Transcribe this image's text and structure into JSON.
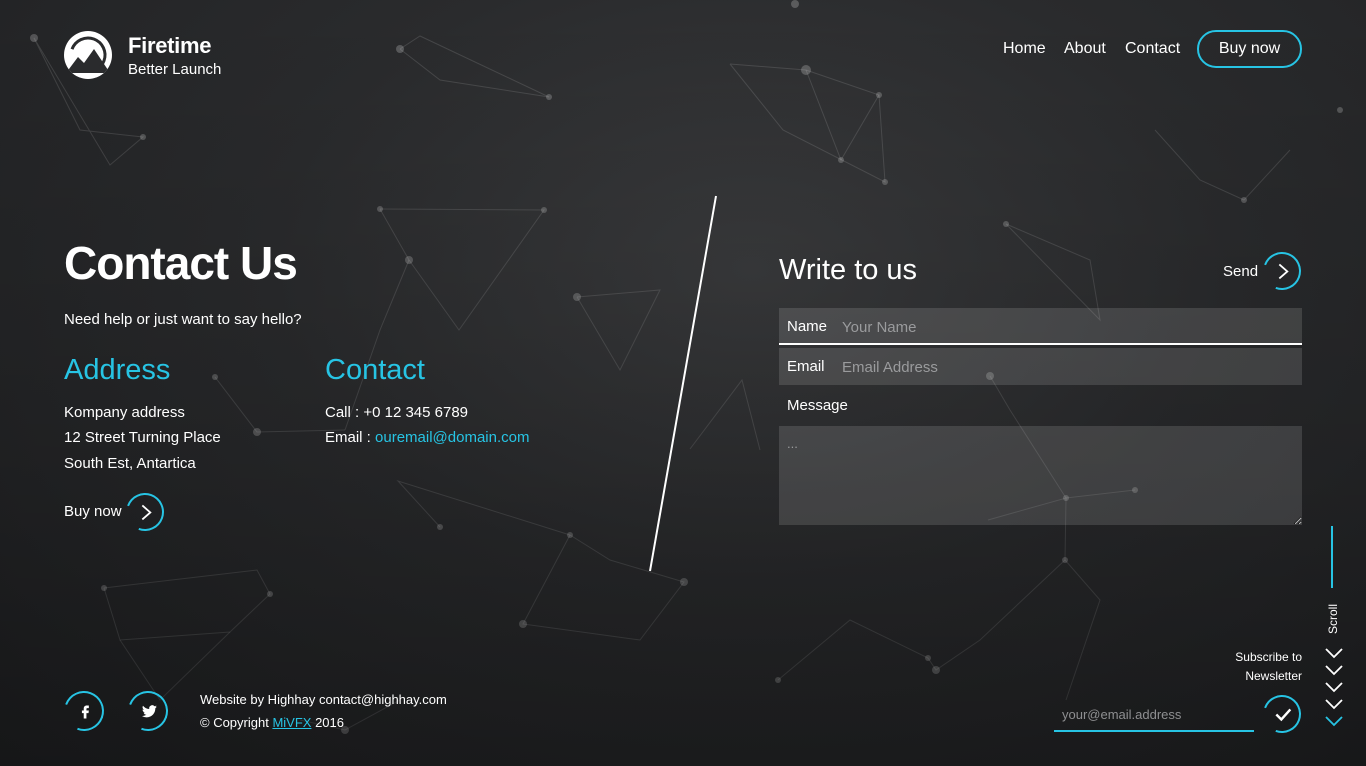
{
  "header": {
    "brand_name": "Firetime",
    "brand_tagline": "Better Launch",
    "nav": {
      "home": "Home",
      "about": "About",
      "contact": "Contact"
    },
    "buy_button": "Buy now"
  },
  "contact": {
    "title": "Contact Us",
    "subtitle": "Need help or just want to say hello?",
    "address_heading": "Address",
    "address_lines": [
      "Kompany address",
      "12 Street Turning Place",
      "South Est, Antartica"
    ],
    "contact_heading": "Contact",
    "call_line": "Call : +0 12 345 6789",
    "email_prefix": "Email : ",
    "email": "ouremail@domain.com",
    "buy_label": "Buy now"
  },
  "form": {
    "title": "Write to us",
    "send_label": "Send",
    "name_label": "Name",
    "name_placeholder": "Your Name",
    "email_label": "Email",
    "email_placeholder": "Email Address",
    "message_label": "Message",
    "message_placeholder": "..."
  },
  "scroll": {
    "label": "Scroll"
  },
  "footer": {
    "credit_line": "Website by Highhay contact@highhay.com",
    "copyright_prefix": "© Copyright ",
    "copyright_link": "MiVFX",
    "copyright_year": " 2016"
  },
  "newsletter": {
    "line1": "Subscribe to",
    "line2": "Newsletter",
    "placeholder": "your@email.address"
  },
  "colors": {
    "accent": "#27c4e4",
    "background": "#2a2b2d",
    "text": "#ffffff"
  }
}
